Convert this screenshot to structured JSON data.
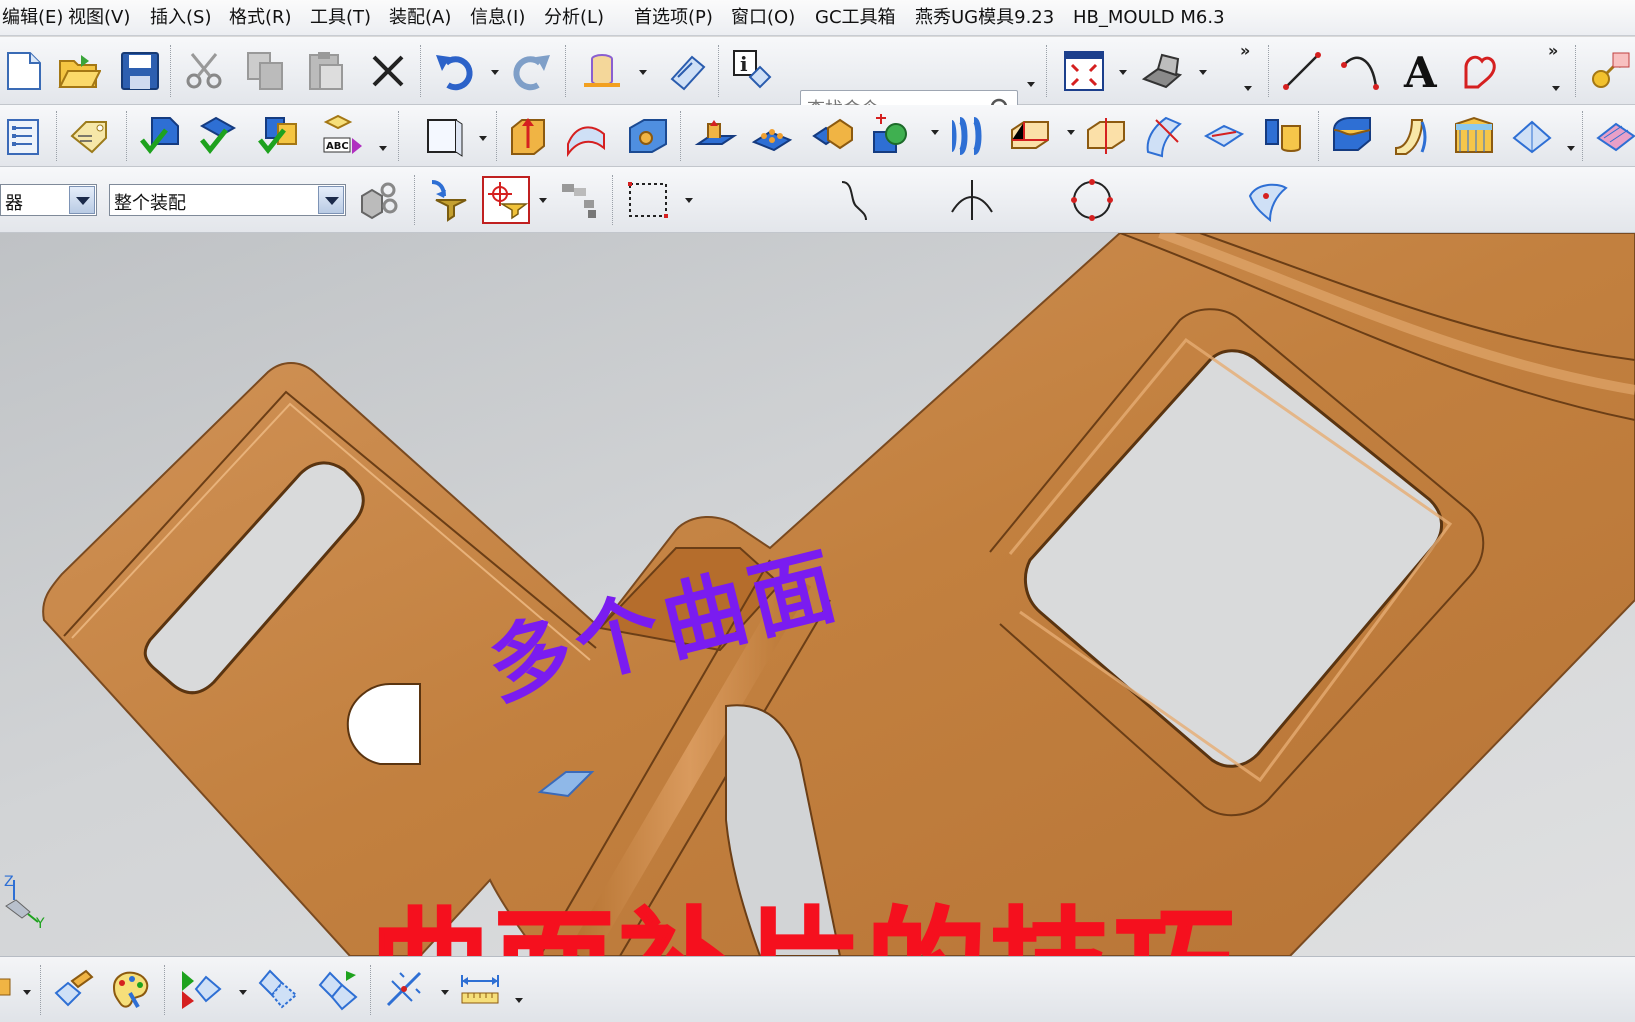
{
  "menu": {
    "items": [
      {
        "label": "编辑(E)"
      },
      {
        "label": "视图(V)"
      },
      {
        "label": "插入(S)"
      },
      {
        "label": "格式(R)"
      },
      {
        "label": "工具(T)"
      },
      {
        "label": "装配(A)"
      },
      {
        "label": "信息(I)"
      },
      {
        "label": "分析(L)"
      },
      {
        "label": "首选项(P)"
      },
      {
        "label": "窗口(O)"
      },
      {
        "label": "GC工具箱"
      },
      {
        "label": "燕秀UG模具9.23"
      },
      {
        "label": "HB_MOULD M6.3"
      }
    ]
  },
  "search": {
    "placeholder": "查找命令"
  },
  "selection_bar": {
    "filter_value": "器",
    "scope_value": "整个装配"
  },
  "overlay": {
    "subtitle": "多个曲面",
    "title": "曲面补片的技巧"
  },
  "triad": {
    "z_label": "Z",
    "y_label": "Y"
  },
  "colors": {
    "part_copper": "#c98a4b",
    "subtitle_purple": "#7a1cf0",
    "title_red": "#f5101e",
    "toolbar_bg": "#e9ebef"
  }
}
